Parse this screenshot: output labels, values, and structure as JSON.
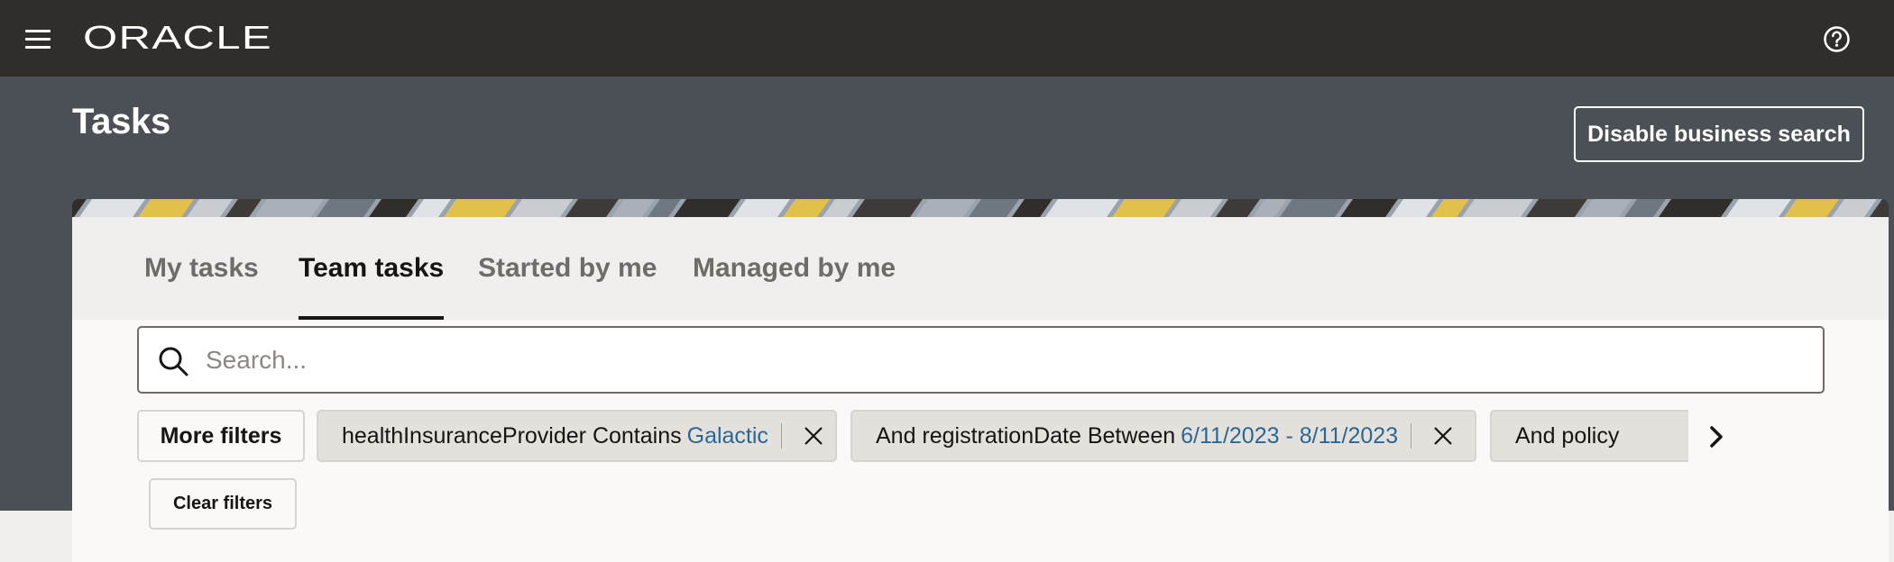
{
  "header": {
    "logo_text": "ORACLE",
    "menu_icon": "hamburger-menu-icon",
    "help_icon": "help-question-icon"
  },
  "page": {
    "title": "Tasks",
    "disable_business_search_label": "Disable business search"
  },
  "tabs": [
    {
      "label": "My tasks",
      "active": false
    },
    {
      "label": "Team tasks",
      "active": true
    },
    {
      "label": "Started by me",
      "active": false
    },
    {
      "label": "Managed by me",
      "active": false
    }
  ],
  "search": {
    "placeholder": "Search...",
    "value": ""
  },
  "filters": {
    "more_filters_label": "More filters",
    "clear_filters_label": "Clear filters",
    "chips": [
      {
        "text": "healthInsuranceProvider Contains",
        "value": "Galactic"
      },
      {
        "text": "And registrationDate Between",
        "value": "6/11/2023 - 8/11/2023"
      },
      {
        "text": "And policy",
        "value": ""
      }
    ]
  },
  "colors": {
    "topbar": "#312d2a",
    "page_background": "#4b5057",
    "card_background": "#fbf9f8",
    "tabs_background": "#f1efed",
    "filter_value": "#2b6795",
    "chip_background": "#e4e1dd"
  }
}
